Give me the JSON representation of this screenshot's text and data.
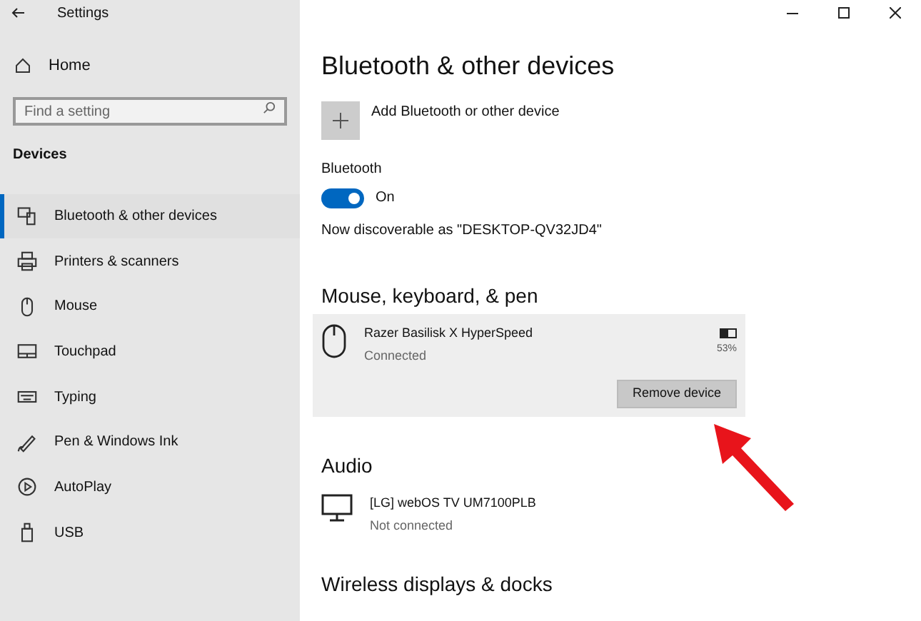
{
  "window": {
    "title": "Settings"
  },
  "sidebar": {
    "home": "Home",
    "search": {
      "placeholder": "Find a setting"
    },
    "section": "Devices",
    "items": [
      {
        "label": "Bluetooth & other devices",
        "selected": true
      },
      {
        "label": "Printers & scanners",
        "selected": false
      },
      {
        "label": "Mouse",
        "selected": false
      },
      {
        "label": "Touchpad",
        "selected": false
      },
      {
        "label": "Typing",
        "selected": false
      },
      {
        "label": "Pen & Windows Ink",
        "selected": false
      },
      {
        "label": "AutoPlay",
        "selected": false
      },
      {
        "label": "USB",
        "selected": false
      }
    ]
  },
  "page": {
    "title": "Bluetooth & other devices",
    "add_button": "Add Bluetooth or other device",
    "bluetooth": {
      "label": "Bluetooth",
      "on": true,
      "state_text": "On",
      "discoverable": "Now discoverable as \"DESKTOP-QV32JD4\""
    },
    "sections": [
      {
        "title": "Mouse, keyboard, & pen",
        "devices": [
          {
            "kind": "mouse",
            "name": "Razer Basilisk X HyperSpeed",
            "status": "Connected",
            "selected": true,
            "battery": {
              "level": 0.53,
              "text": "53%"
            },
            "action": "Remove device"
          }
        ]
      },
      {
        "title": "Audio",
        "devices": [
          {
            "kind": "monitor",
            "name": "[LG] webOS TV UM7100PLB",
            "status": "Not connected",
            "selected": false
          }
        ]
      },
      {
        "title": "Wireless displays & docks"
      }
    ]
  }
}
